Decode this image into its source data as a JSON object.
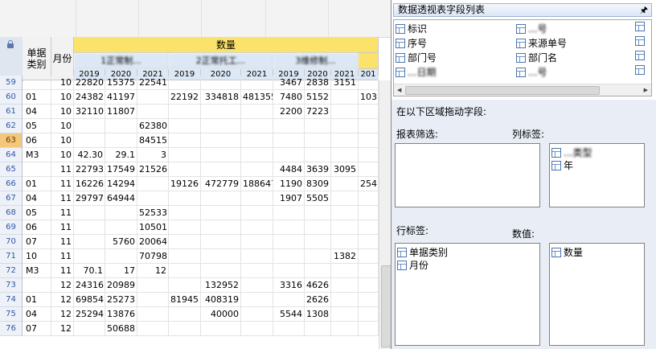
{
  "colors": {
    "header_yellow": "#fbe26b",
    "header_blue": "#dde8f6",
    "selected_row": "#f5c77b",
    "row_num": "#2e57a6"
  },
  "table": {
    "h_doc_type": "单据类别",
    "h_month": "月份",
    "h_quantity": "数量",
    "groups": [
      "1正常制...",
      "2正常托工...",
      "3维修制..."
    ],
    "years": [
      "2019",
      "2020",
      "2021",
      "2019",
      "2020",
      "2021",
      "2019",
      "2020",
      "2021",
      "201"
    ],
    "rows": [
      {
        "n": "59",
        "c": [
          "",
          "10",
          "22820",
          "15375",
          "22541",
          "",
          "",
          "",
          "3467",
          "2838",
          "3151",
          ""
        ]
      },
      {
        "n": "60",
        "c": [
          "01",
          "10",
          "24382",
          "41197",
          "",
          "22192",
          "334818",
          "481355",
          "7480",
          "5152",
          "",
          "103"
        ]
      },
      {
        "n": "61",
        "c": [
          "04",
          "10",
          "32110",
          "11807",
          "",
          "",
          "",
          "",
          "2200",
          "7223",
          "",
          ""
        ]
      },
      {
        "n": "62",
        "c": [
          "05",
          "10",
          "",
          "",
          "62380",
          "",
          "",
          "",
          "",
          "",
          "",
          ""
        ]
      },
      {
        "n": "63",
        "c": [
          "06",
          "10",
          "",
          "",
          "84515",
          "",
          "",
          "",
          "",
          "",
          "",
          ""
        ]
      },
      {
        "n": "64",
        "c": [
          "M3",
          "10",
          "42.30",
          "29.1",
          "3",
          "",
          "",
          "",
          "",
          "",
          "",
          ""
        ]
      },
      {
        "n": "65",
        "c": [
          "",
          "11",
          "22793",
          "17549",
          "21526",
          "",
          "",
          "",
          "4484",
          "3639",
          "3095",
          ""
        ]
      },
      {
        "n": "66",
        "c": [
          "01",
          "11",
          "16226",
          "14294",
          "",
          "19126",
          "472779",
          "188647",
          "1190",
          "8309",
          "",
          "254"
        ]
      },
      {
        "n": "67",
        "c": [
          "04",
          "11",
          "29797",
          "64944",
          "",
          "",
          "",
          "",
          "1907",
          "5505",
          "",
          ""
        ]
      },
      {
        "n": "68",
        "c": [
          "05",
          "11",
          "",
          "",
          "52533",
          "",
          "",
          "",
          "",
          "",
          "",
          ""
        ]
      },
      {
        "n": "69",
        "c": [
          "06",
          "11",
          "",
          "",
          "10501",
          "",
          "",
          "",
          "",
          "",
          "",
          ""
        ]
      },
      {
        "n": "70",
        "c": [
          "07",
          "11",
          "",
          "5760",
          "20064",
          "",
          "",
          "",
          "",
          "",
          "",
          ""
        ]
      },
      {
        "n": "71",
        "c": [
          "10",
          "11",
          "",
          "",
          "70798",
          "",
          "",
          "",
          "",
          "",
          "1382",
          ""
        ]
      },
      {
        "n": "72",
        "c": [
          "M3",
          "11",
          "70.1",
          "17",
          "12",
          "",
          "",
          "",
          "",
          "",
          "",
          ""
        ]
      },
      {
        "n": "73",
        "c": [
          "",
          "12",
          "24316",
          "20989",
          "",
          "",
          "132952",
          "",
          "3316",
          "4626",
          "",
          ""
        ]
      },
      {
        "n": "74",
        "c": [
          "01",
          "12",
          "69854",
          "25273",
          "",
          "81945",
          "408319",
          "",
          "",
          "2626",
          "",
          ""
        ]
      },
      {
        "n": "75",
        "c": [
          "04",
          "12",
          "25294",
          "13876",
          "",
          "",
          "40000",
          "",
          "5544",
          "1308",
          "",
          ""
        ]
      },
      {
        "n": "76",
        "c": [
          "07",
          "12",
          "",
          "50688",
          "",
          "",
          "",
          "",
          "",
          "",
          "",
          ""
        ]
      }
    ],
    "selected_row": "63"
  },
  "pivot": {
    "title": "数据透视表字段列表",
    "pin": "🖈",
    "fields_col1": [
      "标识",
      "序号",
      "部门号",
      "...日期"
    ],
    "fields_col2": [
      "...号",
      "来源单号",
      "部门名",
      "...号"
    ],
    "drag_hint": "在以下区域拖动字段:",
    "filter_label": "报表筛选:",
    "col_label": "列标签:",
    "row_label": "行标签:",
    "value_label": "数值:",
    "col_items": [
      "...类型",
      "年"
    ],
    "row_items": [
      "单据类别",
      "月份"
    ],
    "value_items": [
      "数量"
    ]
  }
}
